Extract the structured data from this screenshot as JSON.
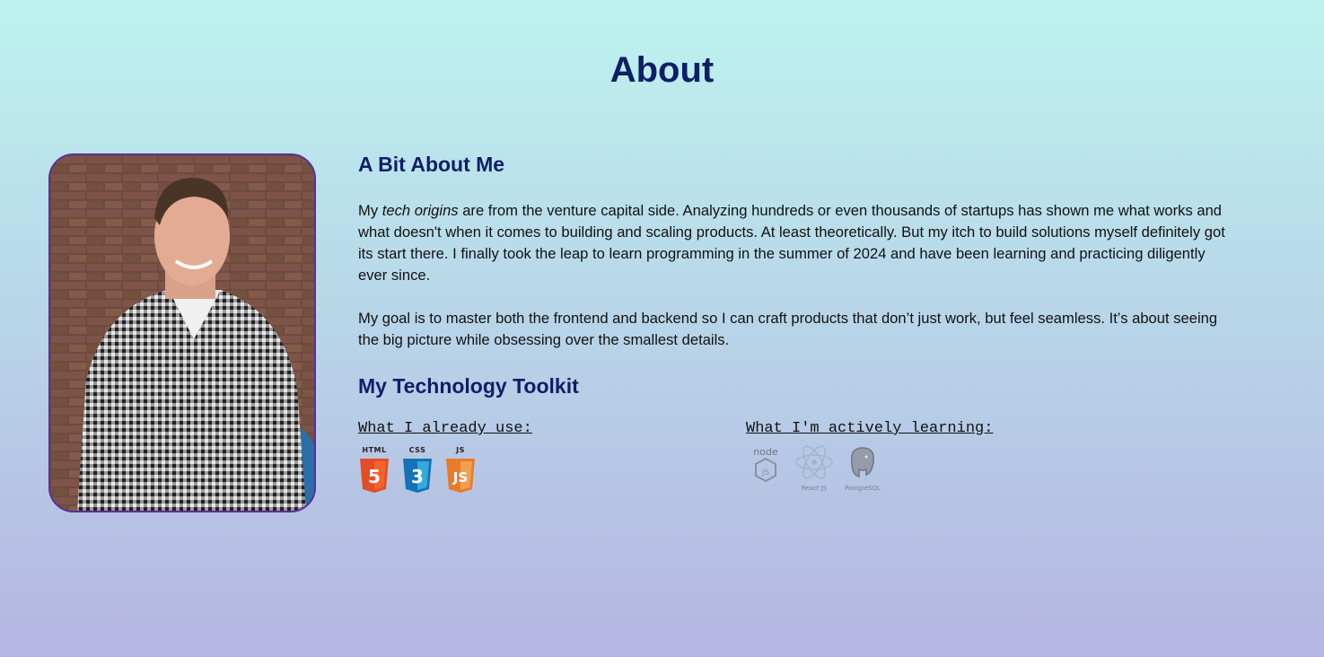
{
  "page": {
    "title": "About"
  },
  "photo": {
    "alt": "Portrait photo"
  },
  "bio": {
    "heading": "A Bit About Me",
    "p1_before": "My ",
    "p1_em": "tech origins",
    "p1_after": " are from the venture capital side. Analyzing hundreds or even thousands of startups has shown me what works and what doesn't when it comes to building and scaling products. At least theoretically. But my itch to build solutions myself definitely got its start there. I finally took the leap to learn programming in the summer of 2024 and have been learning and practicing diligently ever since.",
    "p2": "My goal is to master both the frontend and backend so I can craft products that don’t just work, but feel seamless. It’s about seeing the big picture while obsessing over the smallest details."
  },
  "toolkit": {
    "heading": "My Technology Toolkit",
    "using_title": "What I already use:",
    "learning_title": "What I'm actively learning:",
    "using": [
      {
        "label": "HTML",
        "glyph": "5",
        "color": "#e44d26",
        "icon": "html5-icon"
      },
      {
        "label": "CSS",
        "glyph": "3",
        "color": "#1572b6",
        "icon": "css3-icon"
      },
      {
        "label": "JS",
        "glyph": "JS",
        "color": "#e87b2c",
        "icon": "js-icon"
      }
    ],
    "learning": [
      {
        "label": "node",
        "icon": "nodejs-icon"
      },
      {
        "label": "React JS",
        "icon": "react-icon"
      },
      {
        "label": "PostgreSQL",
        "icon": "postgresql-icon"
      }
    ]
  }
}
